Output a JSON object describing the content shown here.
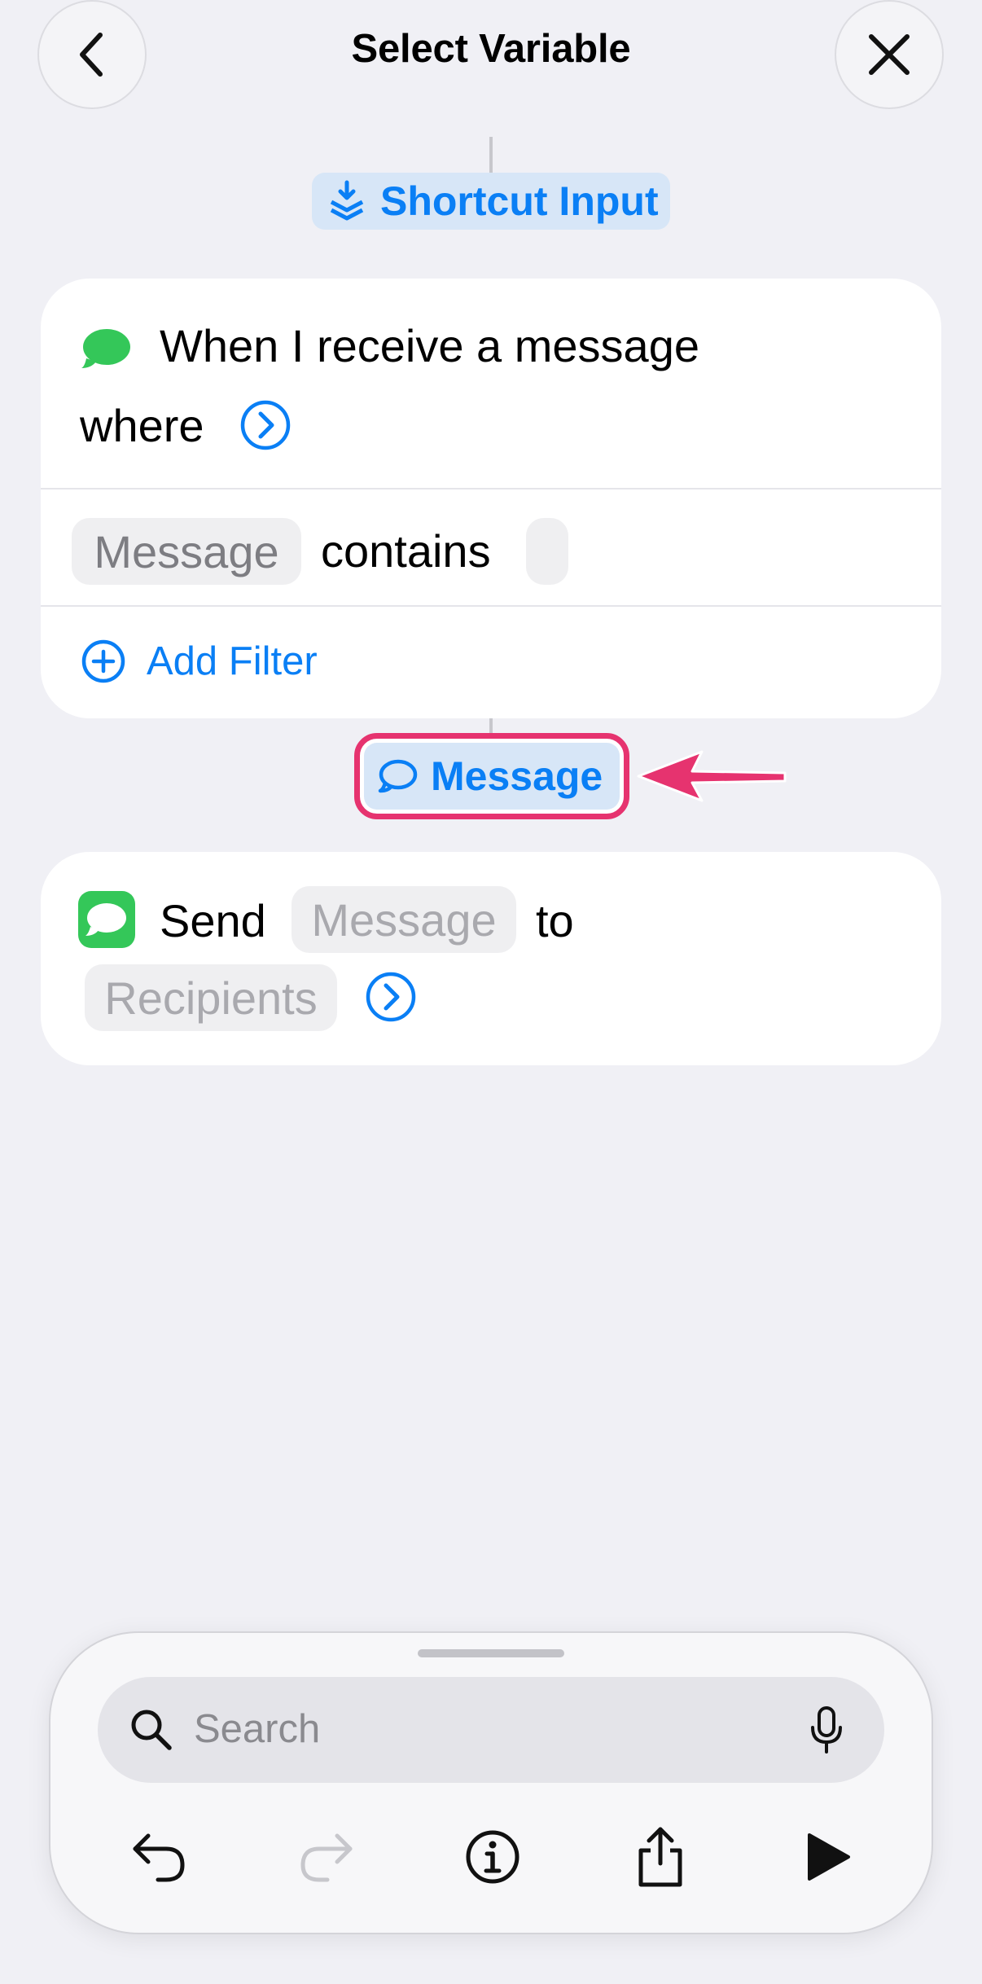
{
  "nav": {
    "title": "Select Variable",
    "back_icon": "chevron-left-icon",
    "close_icon": "xmark-icon"
  },
  "shortcut_input": {
    "label": "Shortcut Input",
    "icon": "layers-icon"
  },
  "trigger_card": {
    "title_line1": "When I receive a message",
    "title_line2": "where",
    "expand_icon": "chevron-right-circle-icon",
    "filter": {
      "field": "Message",
      "operator": "contains",
      "value": ""
    },
    "add_filter_label": "Add Filter"
  },
  "message_variable": {
    "label": "Message",
    "icon": "speech-bubble-icon",
    "highlight_color": "#e6336f"
  },
  "send_card": {
    "verb": "Send",
    "message_placeholder": "Message",
    "connector_word": "to",
    "recipients_placeholder": "Recipients",
    "expand_icon": "chevron-right-circle-icon"
  },
  "toolbar": {
    "search_placeholder": "Search",
    "icons": [
      "undo-icon",
      "redo-icon",
      "info-icon",
      "share-icon",
      "play-icon"
    ]
  },
  "colors": {
    "accent": "#0a7ff5",
    "messages_green": "#34c759",
    "highlight": "#e6336f",
    "background": "#f0f0f5"
  }
}
